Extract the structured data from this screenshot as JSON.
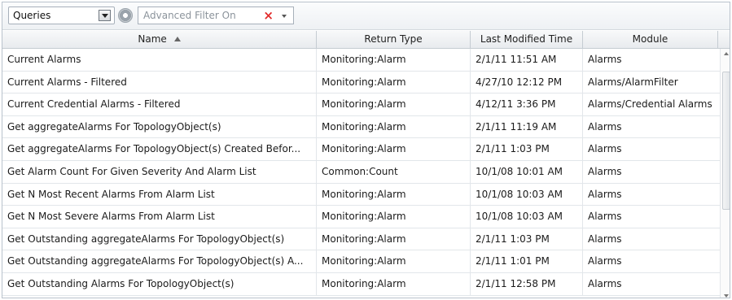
{
  "toolbar": {
    "selector_value": "Queries",
    "filter_placeholder": "Advanced Filter On",
    "clear_glyph": "×"
  },
  "columns": [
    {
      "label": "Name",
      "sorted": "ascending"
    },
    {
      "label": "Return Type"
    },
    {
      "label": "Last Modified Time"
    },
    {
      "label": "Module"
    }
  ],
  "rows": [
    {
      "name": "Current Alarms",
      "return_type": "Monitoring:Alarm",
      "modified": "2/1/11 11:51 AM",
      "module": "Alarms"
    },
    {
      "name": "Current Alarms - Filtered",
      "return_type": "Monitoring:Alarm",
      "modified": "4/27/10 12:12 PM",
      "module": "Alarms/AlarmFilter"
    },
    {
      "name": "Current Credential Alarms - Filtered",
      "return_type": "Monitoring:Alarm",
      "modified": "4/12/11 3:36 PM",
      "module": "Alarms/Credential Alarms"
    },
    {
      "name": "Get aggregateAlarms For TopologyObject(s)",
      "return_type": "Monitoring:Alarm",
      "modified": "2/1/11 11:19 AM",
      "module": "Alarms"
    },
    {
      "name": "Get aggregateAlarms For TopologyObject(s) Created Befor...",
      "return_type": "Monitoring:Alarm",
      "modified": "2/1/11 1:03 PM",
      "module": "Alarms"
    },
    {
      "name": "Get Alarm Count For Given Severity And Alarm List",
      "return_type": "Common:Count",
      "modified": "10/1/08 10:01 AM",
      "module": "Alarms"
    },
    {
      "name": "Get N Most Recent Alarms From Alarm List",
      "return_type": "Monitoring:Alarm",
      "modified": "10/1/08 10:03 AM",
      "module": "Alarms"
    },
    {
      "name": "Get N Most Severe Alarms From Alarm List",
      "return_type": "Monitoring:Alarm",
      "modified": "10/1/08 10:03 AM",
      "module": "Alarms"
    },
    {
      "name": "Get Outstanding aggregateAlarms For TopologyObject(s)",
      "return_type": "Monitoring:Alarm",
      "modified": "2/1/11 1:03 PM",
      "module": "Alarms"
    },
    {
      "name": "Get Outstanding aggregateAlarms For TopologyObject(s) A...",
      "return_type": "Monitoring:Alarm",
      "modified": "2/1/11 1:01 PM",
      "module": "Alarms"
    },
    {
      "name": "Get Outstanding Alarms For TopologyObject(s)",
      "return_type": "Monitoring:Alarm",
      "modified": "2/1/11 12:58 PM",
      "module": "Alarms"
    }
  ],
  "icons": {
    "selector_dropdown": "chevron-down-icon",
    "options": "gear-icon",
    "clear_filter": "close-icon",
    "filter_menu": "chevron-down-icon",
    "sort": "sort-ascending-icon"
  },
  "colors": {
    "clear_filter": "#e22b2b",
    "header_border": "#c5ccd2"
  }
}
